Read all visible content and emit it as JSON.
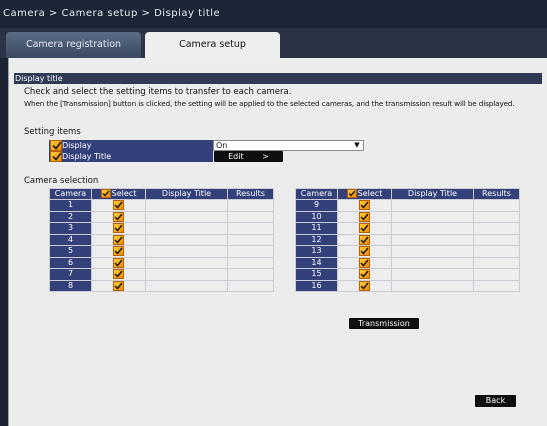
{
  "breadcrumb": "Camera > Camera setup > Display title",
  "tabs": [
    {
      "label": "Camera registration",
      "active": false
    },
    {
      "label": "Camera setup",
      "active": true
    }
  ],
  "section_title": "Display title",
  "description_line1": "Check and select the setting items to transfer to each camera.",
  "description_line2": "When the [Transmission] button is clicked, the setting will be applied to the selected cameras, and the transmission result will be displayed.",
  "setting_items": {
    "heading": "Setting items",
    "display": {
      "label": "Display",
      "value": "On",
      "checked": true
    },
    "display_title": {
      "label": "Display Title",
      "button_label": "Edit",
      "button_icon": "chevron-right-icon",
      "checked": true
    }
  },
  "camera_selection": {
    "heading": "Camera selection",
    "columns": {
      "camera": "Camera",
      "select": "Select",
      "display_title": "Display Title",
      "results": "Results"
    },
    "left_cameras": [
      "1",
      "2",
      "3",
      "4",
      "5",
      "6",
      "7",
      "8"
    ],
    "right_cameras": [
      "9",
      "10",
      "11",
      "12",
      "13",
      "14",
      "15",
      "16"
    ]
  },
  "transmission_label": "Transmission",
  "back_label": "Back",
  "colors": {
    "header_blue": "#34407a",
    "checkbox_orange": "#f5a000",
    "button_black": "#0e0e0e"
  }
}
